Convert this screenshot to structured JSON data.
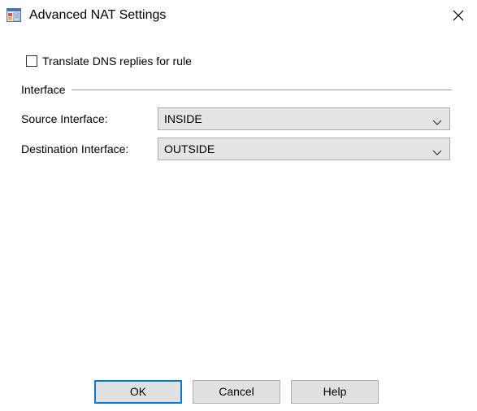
{
  "window": {
    "title": "Advanced NAT Settings"
  },
  "icons": {
    "app": "nat-settings-app-icon",
    "close": "close-icon",
    "dropdown": "chevron-down-icon"
  },
  "options": {
    "translate_dns_label": "Translate DNS replies for rule",
    "translate_dns_checked": false
  },
  "interface_group": {
    "title": "Interface",
    "source": {
      "label": "Source Interface:",
      "value": "INSIDE"
    },
    "destination": {
      "label": "Destination Interface:",
      "value": "OUTSIDE"
    }
  },
  "buttons": {
    "ok": "OK",
    "cancel": "Cancel",
    "help": "Help"
  },
  "colors": {
    "default_button_border": "#0078d7",
    "combo_background": "#e5e5e5",
    "button_background": "#e1e1e1"
  }
}
